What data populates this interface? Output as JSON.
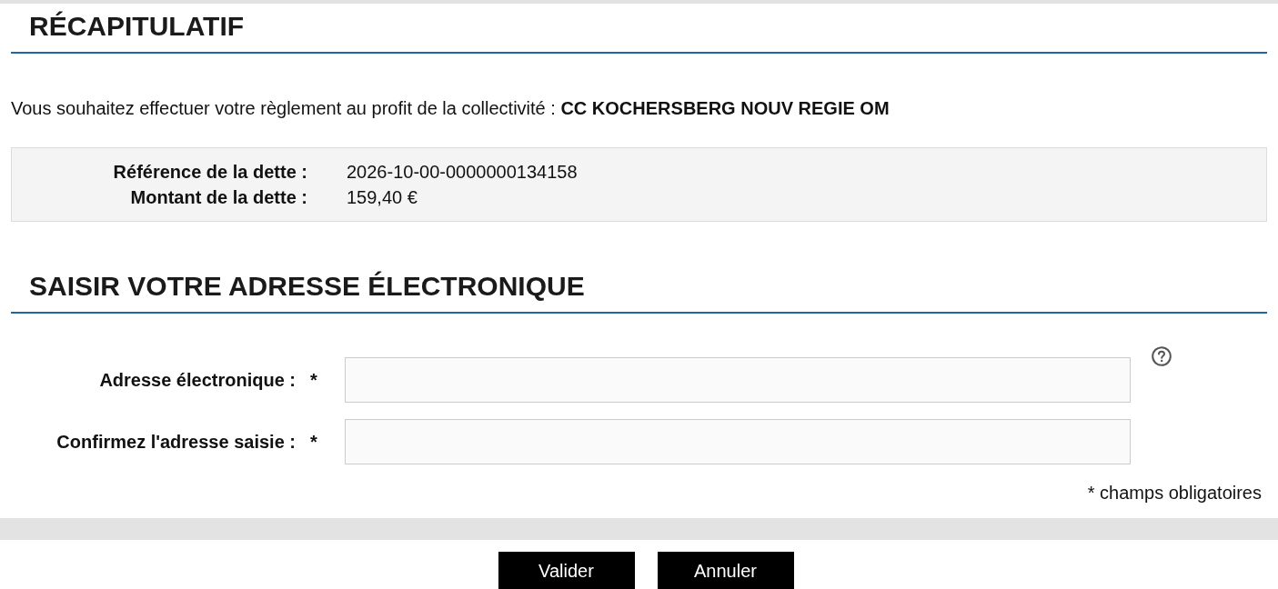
{
  "summary": {
    "heading": "RÉCAPITULATIF",
    "intro": "Vous souhaitez effectuer votre règlement au profit de la collectivité : **CC KOCHERSBERG NOUV REGIE OM**",
    "details": [
      {
        "label": "Référence de la dette :",
        "value": "2026-10-00-0000000134158"
      },
      {
        "label": "Montant de la dette :",
        "value": "159,40 €"
      }
    ]
  },
  "email_form": {
    "heading": "SAISIR VOTRE ADRESSE ÉLECTRONIQUE",
    "fields": [
      {
        "label": "Adresse électronique :",
        "required_mark": "*",
        "help": true
      },
      {
        "label": "Confirmez l'adresse saisie :",
        "required_mark": "*",
        "help": false
      }
    ],
    "required_note": "* champs obligatoires"
  },
  "buttons": [
    {
      "label": "Valider"
    },
    {
      "label": "Annuler"
    }
  ]
}
